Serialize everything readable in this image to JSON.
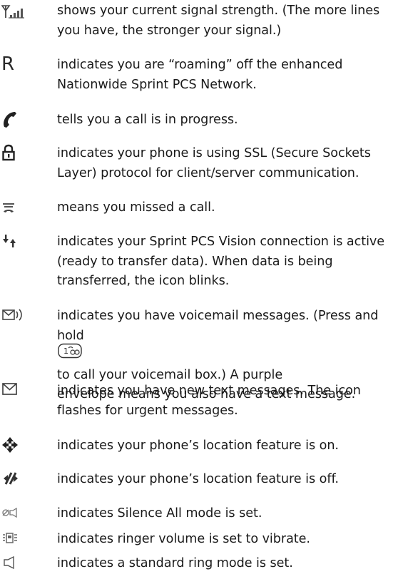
{
  "entries": [
    {
      "icon": "signal-strength-icon",
      "lines": [
        "shows your current signal strength. (The more lines",
        "you have, the stronger your signal.)"
      ]
    },
    {
      "icon": "roaming-icon",
      "icon_text": "R",
      "lines": [
        "indicates you are “roaming” off the enhanced",
        "Nationwide Sprint PCS Network."
      ]
    },
    {
      "icon": "call-in-progress-icon",
      "lines": [
        "tells you a call is in progress."
      ]
    },
    {
      "icon": "lock-ssl-icon",
      "lines": [
        "indicates your phone is using SSL (Secure Sockets",
        "Layer) protocol for client/server communication."
      ]
    },
    {
      "icon": "missed-call-icon",
      "lines": [
        "means you missed a call."
      ]
    },
    {
      "icon": "vision-connection-icon",
      "lines": [
        "indicates your Sprint PCS Vision connection is active",
        "(ready to transfer data). When data is being",
        "transferred, the icon blinks."
      ]
    },
    {
      "icon": "voicemail-icon",
      "lines": [
        "indicates you have voicemail messages. (Press and",
        "hold",
        "to call your voicemail box.) A purple",
        "envelope means you also have a text message."
      ]
    },
    {
      "icon": "envelope-icon",
      "lines": [
        "indicates you have new text messages. The icon",
        "flashes for urgent messages."
      ]
    },
    {
      "icon": "location-on-icon",
      "lines": [
        "indicates your phone’s location feature is on."
      ]
    },
    {
      "icon": "location-off-icon",
      "lines": [
        "indicates your phone’s location feature is off."
      ]
    },
    {
      "icon": "silence-all-icon",
      "lines": [
        "indicates Silence All mode is set."
      ]
    },
    {
      "icon": "vibrate-icon",
      "lines": [
        "indicates ringer volume is set to vibrate."
      ]
    },
    {
      "icon": "ring-mode-icon",
      "lines": [
        "indicates a standard ring mode is set."
      ]
    }
  ],
  "key_icon": "voicemail-key-icon"
}
